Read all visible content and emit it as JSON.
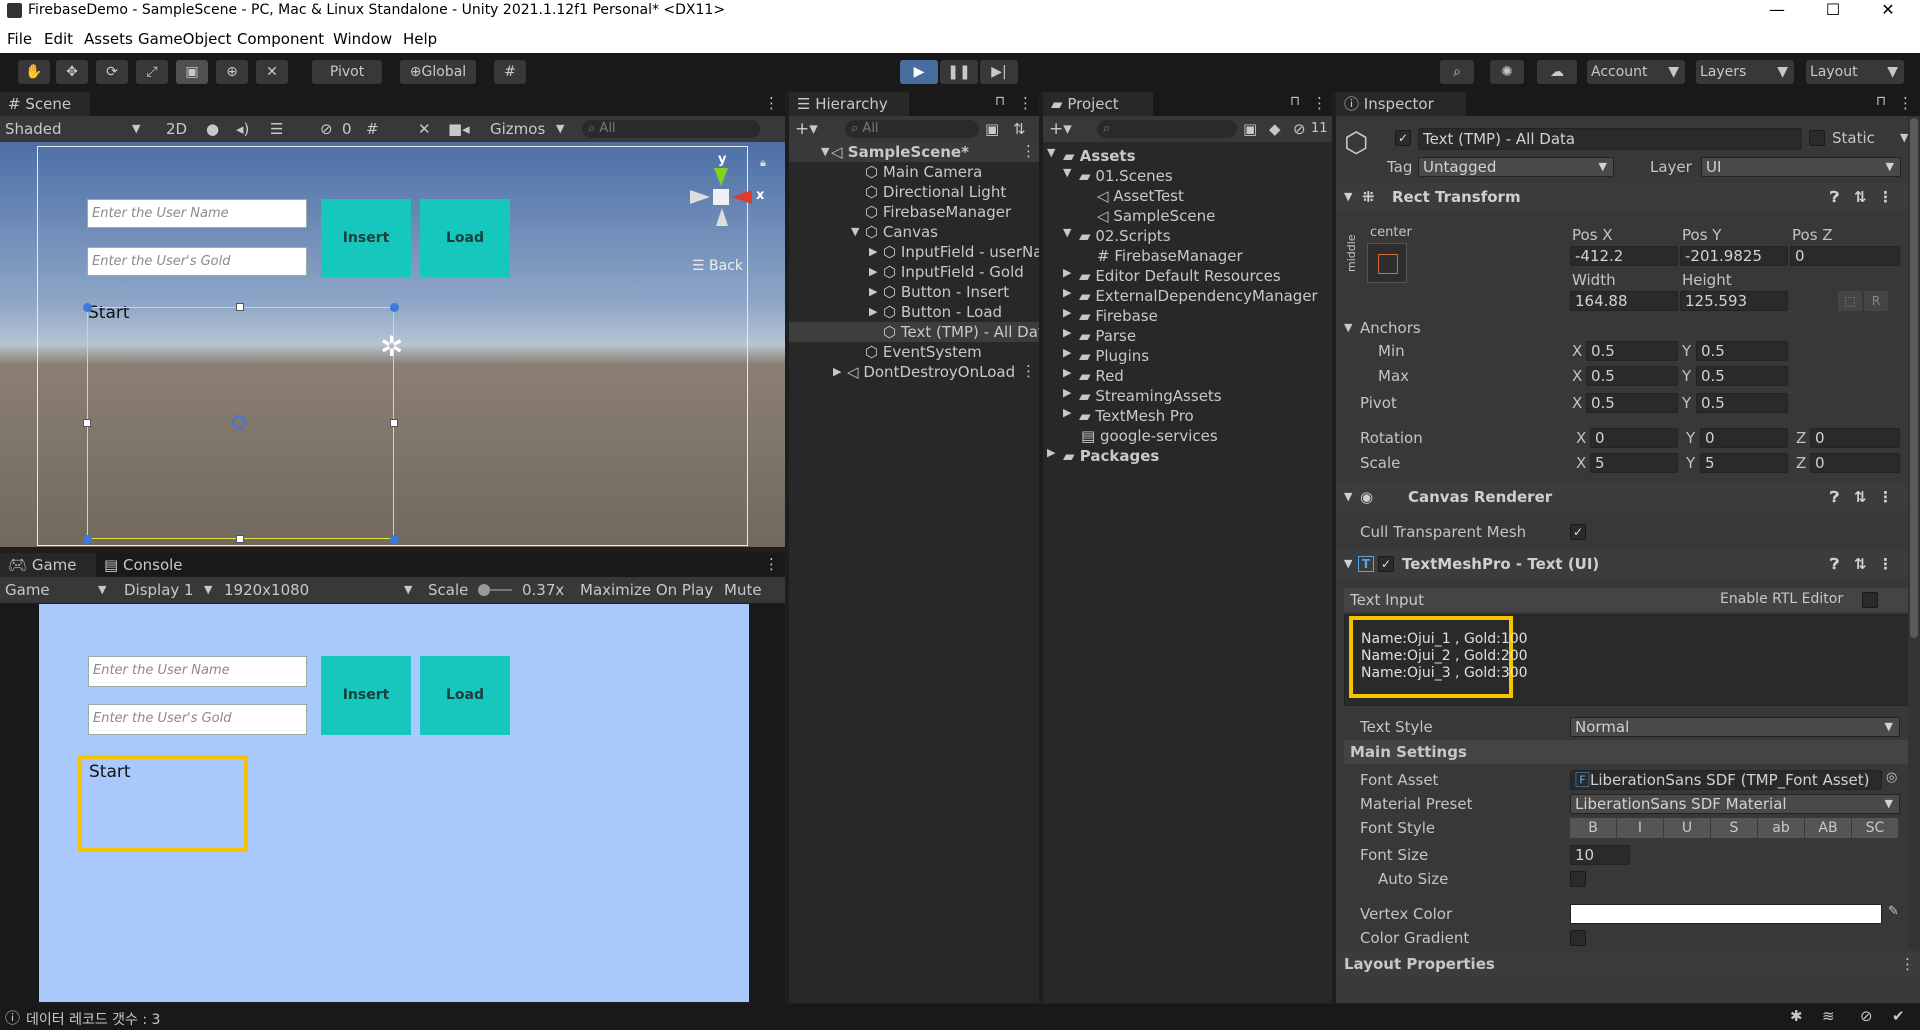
{
  "window": {
    "title": "FirebaseDemo - SampleScene - PC, Mac & Linux Standalone - Unity 2021.1.12f1 Personal* <DX11>"
  },
  "menu": [
    "File",
    "Edit",
    "Assets",
    "GameObject",
    "Component",
    "Window",
    "Help"
  ],
  "toolbar": {
    "pivot": "Pivot",
    "global": "Global",
    "account": "Account",
    "layers": "Layers",
    "layout": "Layout"
  },
  "scene": {
    "tab": "Scene",
    "shading": "Shaded",
    "mode2d": "2D",
    "hidden_count": "0",
    "gizmos": "Gizmos",
    "search_placeholder": "All",
    "back_label": "Back",
    "axis_x": "x",
    "axis_y": "y"
  },
  "game": {
    "tab_game": "Game",
    "tab_console": "Console",
    "game_label": "Game",
    "display": "Display 1",
    "resolution": "1920x1080",
    "scale_label": "Scale",
    "scale_value": "0.37x",
    "maximize": "Maximize On Play",
    "mute": "Mute Audio"
  },
  "ui_preview": {
    "user_name_placeholder": "Enter the User Name",
    "user_gold_placeholder": "Enter the User's Gold",
    "insert": "Insert",
    "load": "Load",
    "start": "Start"
  },
  "hierarchy": {
    "tab": "Hierarchy",
    "search_placeholder": "All",
    "rows": [
      "SampleScene*",
      "Main Camera",
      "Directional Light",
      "FirebaseManager",
      "Canvas",
      "InputField - userName",
      "InputField - Gold",
      "Button - Insert",
      "Button - Load",
      "Text (TMP) - All Data",
      "EventSystem",
      "DontDestroyOnLoad"
    ]
  },
  "project": {
    "tab": "Project",
    "hidden_count": "11",
    "rows": [
      "Assets",
      "01.Scenes",
      "AssetTest",
      "SampleScene",
      "02.Scripts",
      "FirebaseManager",
      "Editor Default Resources",
      "ExternalDependencyManager",
      "Firebase",
      "Parse",
      "Plugins",
      "Red",
      "StreamingAssets",
      "TextMesh Pro",
      "google-services",
      "Packages"
    ]
  },
  "inspector": {
    "tab": "Inspector",
    "object_name": "Text (TMP) - All Data",
    "static": "Static",
    "tag_label": "Tag",
    "tag": "Untagged",
    "layer_label": "Layer",
    "layer": "UI",
    "rect_transform": {
      "title": "Rect Transform",
      "anchor_h": "center",
      "anchor_v": "middle",
      "pos_x_label": "Pos X",
      "pos_y_label": "Pos Y",
      "pos_z_label": "Pos Z",
      "pos_x": "-412.2",
      "pos_y": "-201.9825",
      "pos_z": "0",
      "width_label": "Width",
      "height_label": "Height",
      "width": "164.88",
      "height": "125.593",
      "anchors": "Anchors",
      "min": "Min",
      "max": "Max",
      "pivot": "Pivot",
      "min_x": "0.5",
      "min_y": "0.5",
      "max_x": "0.5",
      "max_y": "0.5",
      "pivot_x": "0.5",
      "pivot_y": "0.5",
      "rotation": "Rotation",
      "rot_x": "0",
      "rot_y": "0",
      "rot_z": "0",
      "scale": "Scale",
      "scale_x": "5",
      "scale_y": "5",
      "scale_z": "0",
      "x": "X",
      "y": "Y",
      "z": "Z",
      "r": "R"
    },
    "canvas_renderer": {
      "title": "Canvas Renderer",
      "cull": "Cull Transparent Mesh"
    },
    "tmp": {
      "title": "TextMeshPro - Text (UI)",
      "text_input": "Text Input",
      "rtl": "Enable RTL Editor",
      "lines": [
        "Name:Ojui_1 , Gold:100",
        "Name:Ojui_2 , Gold:200",
        "Name:Ojui_3 , Gold:300"
      ],
      "text_style_label": "Text Style",
      "text_style": "Normal",
      "main_settings": "Main Settings",
      "font_asset_label": "Font Asset",
      "font_asset": "LiberationSans SDF (TMP_Font Asset)",
      "material_preset_label": "Material Preset",
      "material_preset": "LiberationSans SDF Material",
      "font_style_label": "Font Style",
      "font_styles": [
        "B",
        "I",
        "U",
        "S",
        "ab",
        "AB",
        "SC"
      ],
      "font_size_label": "Font Size",
      "font_size": "10",
      "auto_size": "Auto Size",
      "vertex_color": "Vertex Color",
      "color_gradient": "Color Gradient",
      "layout_properties": "Layout Properties"
    }
  },
  "status": {
    "message": "데이터 레코드 갯수 : 3"
  },
  "colors": {
    "highlight": "#f5c400",
    "teal": "#16c7bd",
    "game_bg": "#a9c8fb"
  }
}
